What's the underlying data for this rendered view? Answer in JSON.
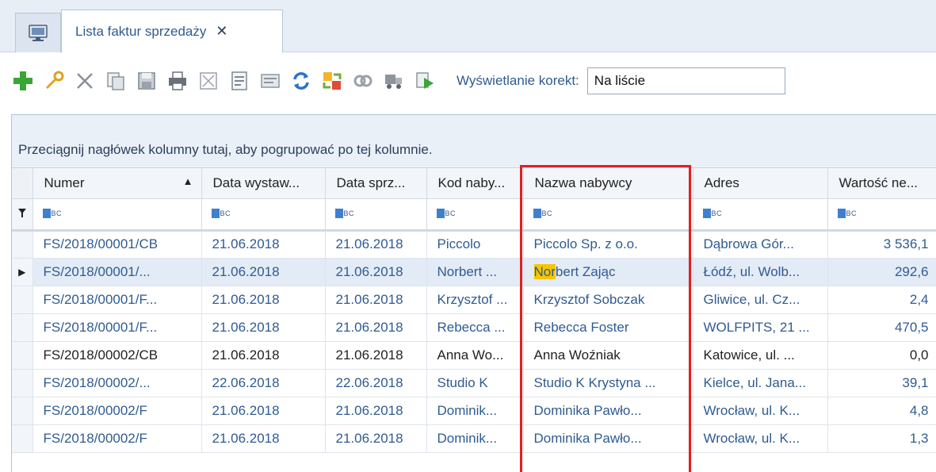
{
  "tabs": {
    "home_icon": "computer-icon",
    "active_title": "Lista faktur sprzedaży",
    "close_glyph": "✕"
  },
  "toolbar": {
    "icons": [
      "add-icon",
      "edit-icon",
      "delete-icon",
      "copy-icon",
      "save-icon",
      "print-icon",
      "cancel-icon",
      "document-icon",
      "report-icon",
      "refresh-icon",
      "exchange-icon",
      "link-icon",
      "truck-icon",
      "play-icon"
    ],
    "korekty_label": "Wyświetlanie korekt:",
    "korekty_value": "Na liście"
  },
  "grid": {
    "group_hint": "Przeciągnij nagłówek kolumny tutaj, aby pogrupować po tej kolumnie.",
    "columns": [
      "Numer",
      "Data wystaw...",
      "Data sprz...",
      "Kod naby...",
      "Nazwa nabywcy",
      "Adres",
      "Wartość ne..."
    ],
    "filter_glyph": "BC",
    "rows": [
      {
        "numer": "FS/2018/00001/CB",
        "data_wyst": "21.06.2018",
        "data_sprz": "21.06.2018",
        "kod": "Piccolo",
        "nazwa": "Piccolo Sp. z o.o.",
        "adres": "Dąbrowa Gór...",
        "wartosc": "3 536,1"
      },
      {
        "numer": "FS/2018/00001/...",
        "data_wyst": "21.06.2018",
        "data_sprz": "21.06.2018",
        "kod": "Norbert ...",
        "nazwa_hl": "Nor",
        "nazwa": "bert Zając",
        "adres": "Łódź, ul. Wolb...",
        "wartosc": "292,6"
      },
      {
        "numer": "FS/2018/00001/F...",
        "data_wyst": "21.06.2018",
        "data_sprz": "21.06.2018",
        "kod": "Krzysztof ...",
        "nazwa": "Krzysztof Sobczak",
        "adres": "Gliwice, ul. Cz...",
        "wartosc": "2,4"
      },
      {
        "numer": "FS/2018/00001/F...",
        "data_wyst": "21.06.2018",
        "data_sprz": "21.06.2018",
        "kod": "Rebecca ...",
        "nazwa": "Rebecca Foster",
        "adres": "WOLFPITS, 21 ...",
        "wartosc": "470,5"
      },
      {
        "numer": "FS/2018/00002/CB",
        "data_wyst": "21.06.2018",
        "data_sprz": "21.06.2018",
        "kod": "Anna Wo...",
        "nazwa": "Anna Woźniak",
        "adres": "Katowice, ul. ...",
        "wartosc": "0,0"
      },
      {
        "numer": "FS/2018/00002/...",
        "data_wyst": "22.06.2018",
        "data_sprz": "22.06.2018",
        "kod": "Studio K",
        "nazwa": "Studio K Krystyna ...",
        "adres": "Kielce, ul. Jana...",
        "wartosc": "39,1"
      },
      {
        "numer": "FS/2018/00002/F",
        "data_wyst": "21.06.2018",
        "data_sprz": "21.06.2018",
        "kod": "Dominik...",
        "nazwa": "Dominika Pawło...",
        "adres": "Wrocław, ul. K...",
        "wartosc": "4,8"
      },
      {
        "numer": "FS/2018/00002/F",
        "data_wyst": "21.06.2018",
        "data_sprz": "21.06.2018",
        "kod": "Dominik...",
        "nazwa": "Dominika Pawło...",
        "adres": "Wrocław, ul. K...",
        "wartosc": "1,3"
      }
    ]
  },
  "colors": {
    "accent_text": "#2f5b91",
    "highlight": "#f7c600",
    "annotation_box": "#e02020"
  }
}
